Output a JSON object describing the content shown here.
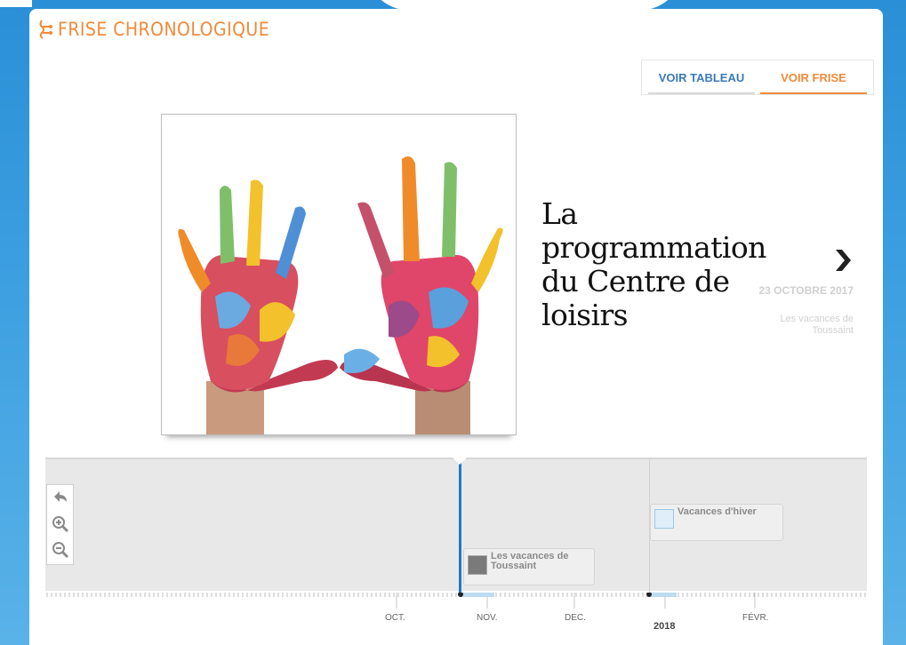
{
  "app": {
    "title": "FRISE CHRONOLOGIQUE",
    "brand_color": "#f08a3a",
    "icon": "timeline-logo-icon"
  },
  "view_tabs": [
    {
      "label": "VOIR TABLEAU",
      "active": false
    },
    {
      "label": "VOIR FRISE",
      "active": true
    }
  ],
  "slide": {
    "image_description_icon": "painted-hands-image",
    "title": "La programmation du Centre de loisirs"
  },
  "next_slide": {
    "icon": "chevron-right-icon",
    "date": "23 OCTOBRE 2017",
    "title": "Les vacances de Toussaint"
  },
  "timeline": {
    "controls": [
      {
        "icon": "back-arrow-icon"
      },
      {
        "icon": "zoom-in-icon"
      },
      {
        "icon": "zoom-out-icon"
      }
    ],
    "events": [
      {
        "title": "Les vacances de Toussaint",
        "thumb_icon": "toussaint-thumbnail"
      },
      {
        "title": "Vacances d'hiver",
        "thumb_icon": "hiver-thumbnail"
      }
    ],
    "axis": {
      "months": [
        "OCT.",
        "NOV.",
        "DEC.",
        "FÉVR."
      ],
      "year": "2018"
    }
  }
}
